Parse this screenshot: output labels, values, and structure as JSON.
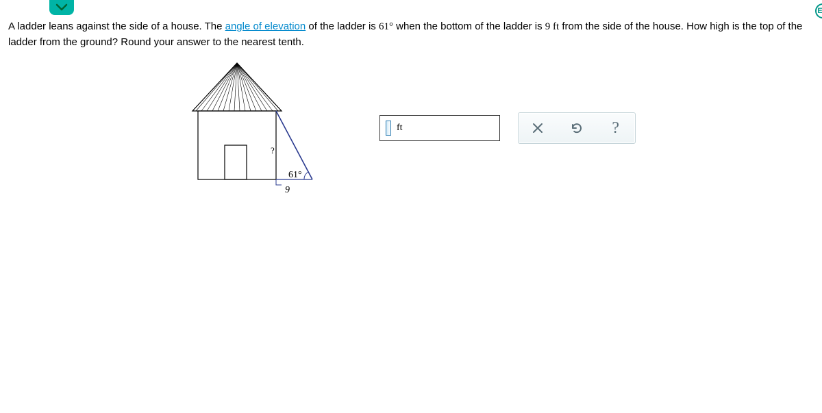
{
  "right_badge": "E",
  "question": {
    "part1": "A ladder leans against the side of a house. The ",
    "link": "angle of elevation",
    "part2": " of the ladder is ",
    "angle": "61°",
    "part3": " when the bottom of the ladder is ",
    "distance": "9 ft",
    "part4": " from the side of the house. How high is the top of the ladder from the ground? Round your answer to the nearest tenth."
  },
  "diagram": {
    "unknown_label": "?",
    "angle_label": "61°",
    "base_label": "9"
  },
  "answer": {
    "value": "",
    "unit": "ft"
  },
  "controls": {
    "clear_title": "Clear",
    "reset_title": "Reset",
    "help_title": "Help"
  }
}
